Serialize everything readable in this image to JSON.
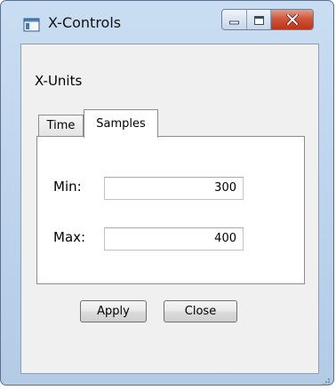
{
  "window": {
    "title": "X-Controls",
    "icon": "app-window-icon"
  },
  "caption_buttons": {
    "minimize_icon": "minimize-icon",
    "maximize_icon": "maximize-icon",
    "close_icon": "close-icon"
  },
  "group": {
    "label": "X-Units"
  },
  "tabs": [
    {
      "label": "Time",
      "selected": false
    },
    {
      "label": "Samples",
      "selected": true
    }
  ],
  "fields": {
    "min": {
      "label": "Min:",
      "value": "300"
    },
    "max": {
      "label": "Max:",
      "value": "400"
    }
  },
  "buttons": {
    "apply": "Apply",
    "close": "Close"
  },
  "colors": {
    "frame": "#bcd3ec",
    "close_button": "#c8432a",
    "client": "#f0f0f0"
  }
}
